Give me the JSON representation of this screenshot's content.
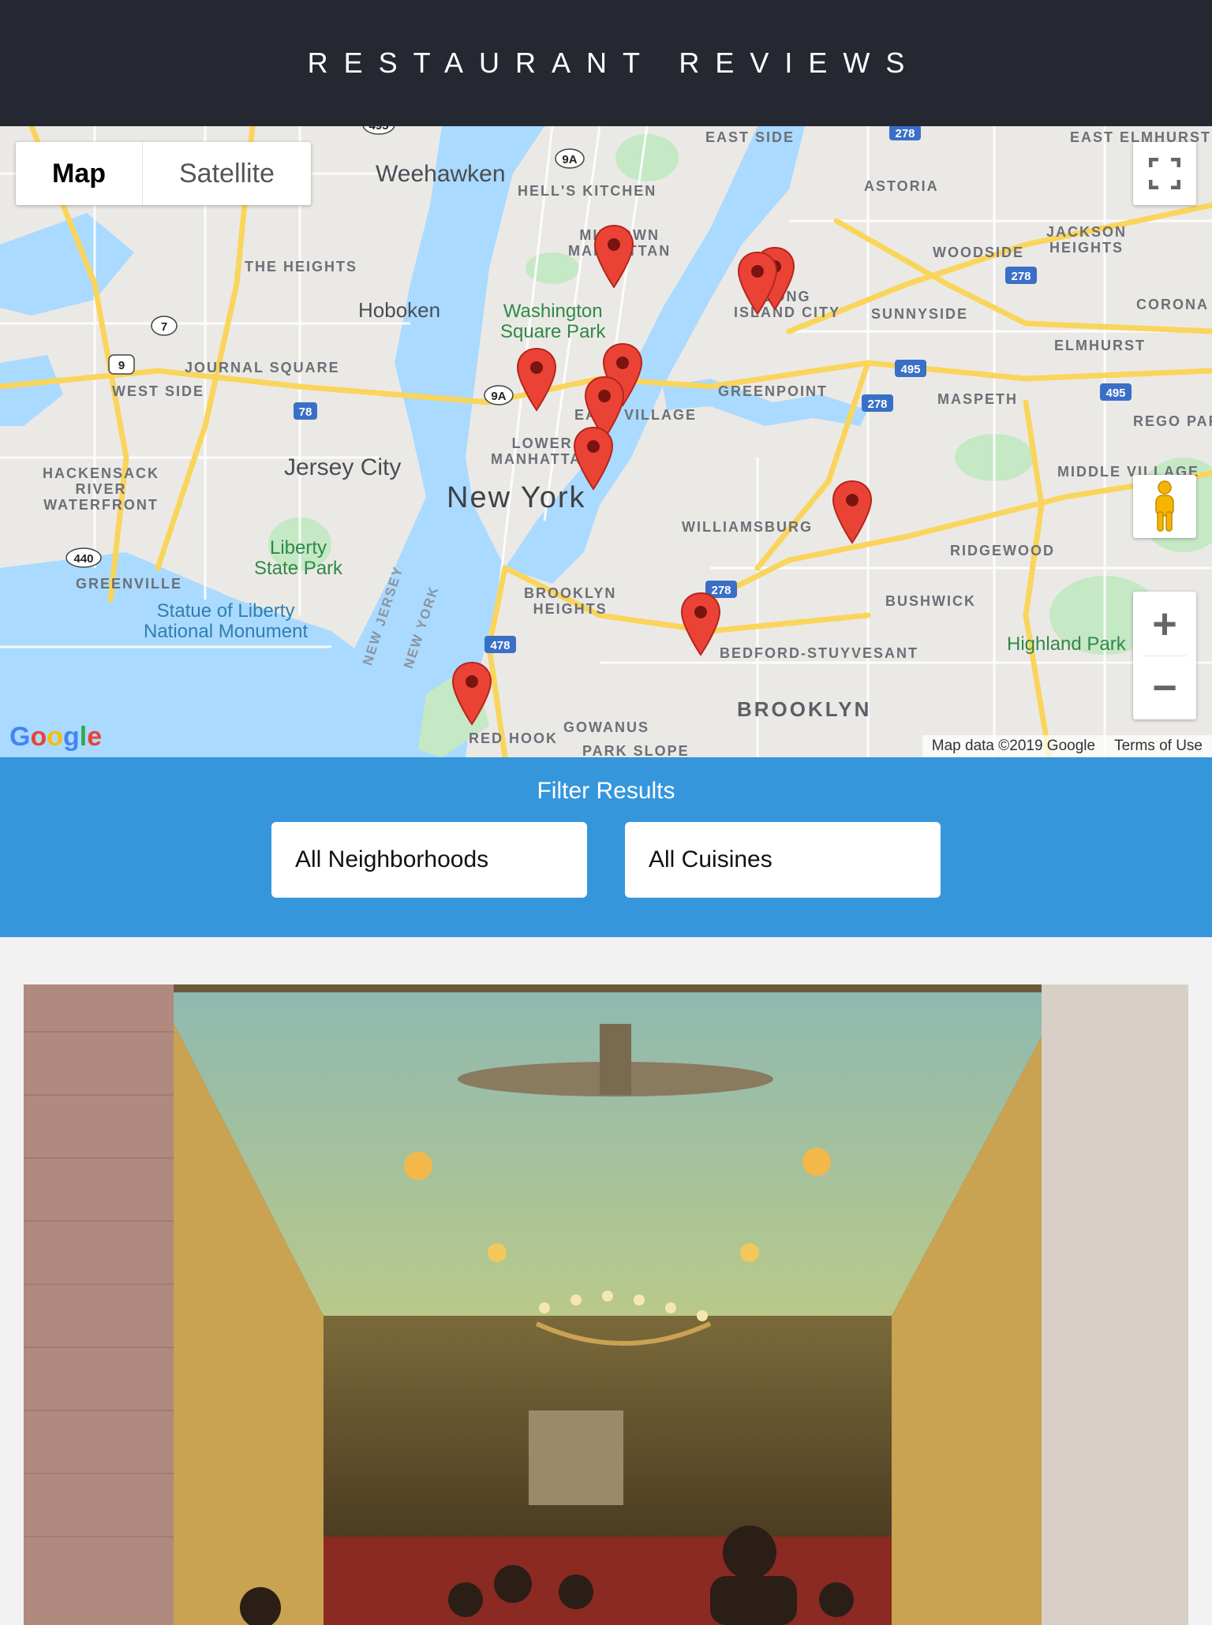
{
  "header": {
    "title": "RESTAURANT REVIEWS"
  },
  "map": {
    "type_controls": {
      "map_label": "Map",
      "satellite_label": "Satellite",
      "active": "Map"
    },
    "labels": {
      "weehawken": "Weehawken",
      "hells_kitchen": "HELL'S KITCHEN",
      "astoria": "ASTORIA",
      "east_elmhurst": "EAST ELMHURST",
      "east_side": "EAST SIDE",
      "the_heights": "THE HEIGHTS",
      "hoboken": "Hoboken",
      "midtown_manhattan": "MIDTOWN\nMANHATTAN",
      "woodside": "WOODSIDE",
      "jackson_heights": "JACKSON\nHEIGHTS",
      "long_island_city": "LONG\nISLAND CITY",
      "sunnyside": "SUNNYSIDE",
      "corona": "CORONA",
      "washington_square_park": "Washington\nSquare Park",
      "elmhurst": "ELMHURST",
      "journal_square": "JOURNAL SQUARE",
      "west_side": "WEST SIDE",
      "greenpoint": "GREENPOINT",
      "maspeth": "MASPETH",
      "rego_park": "REGO PAR",
      "east_village": "EAST VILLAGE",
      "lower_manhattan": "LOWER\nMANHATTAN",
      "hackensack": "HACKENSACK\nRIVER\nWATERFRONT",
      "jersey_city": "Jersey City",
      "new_york": "New York",
      "middle_village": "MIDDLE VILLAGE",
      "williamsburg": "WILLIAMSBURG",
      "ridgewood": "RIDGEWOOD",
      "liberty_state_park": "Liberty\nState Park",
      "greenville": "GREENVILLE",
      "brooklyn_heights": "BROOKLYN\nHEIGHTS",
      "bushwick": "BUSHWICK",
      "statue_of_liberty": "Statue of Liberty\nNational Monument",
      "new_jersey": "NEW JERSEY",
      "new_york_water": "NEW YORK",
      "highland_park": "Highland Park",
      "bedford_stuyvesant": "BEDFORD-STUYVESANT",
      "brooklyn": "BROOKLYN",
      "red_hook": "RED HOOK",
      "gowanus": "GOWANUS",
      "park_slope": "PARK SLOPE"
    },
    "shields": {
      "r278a": "278",
      "r278b": "278",
      "r278c": "278",
      "r278d": "278",
      "r495a": "495",
      "r495b": "495",
      "r78": "78",
      "r478": "478",
      "r7": "7",
      "r9": "9",
      "r9a_top": "9A",
      "r9a_mid": "9A",
      "r440": "440",
      "r495_top": "495"
    },
    "zoom": {
      "in": "+",
      "out": "−"
    },
    "google_logo": {
      "g1": "G",
      "o1": "o",
      "o2": "o",
      "g2": "g",
      "l": "l",
      "e": "e"
    },
    "attribution": {
      "data": "Map data ©2019 Google",
      "terms": "Terms of Use"
    },
    "colors": {
      "water": "#aadaff",
      "land": "#ebe9e5",
      "park": "#c5e8c5",
      "highway": "#f9d55c",
      "marker": "#ea4335"
    }
  },
  "filter": {
    "title": "Filter Results",
    "neighborhood_value": "All Neighborhoods",
    "cuisine_value": "All Cuisines"
  }
}
